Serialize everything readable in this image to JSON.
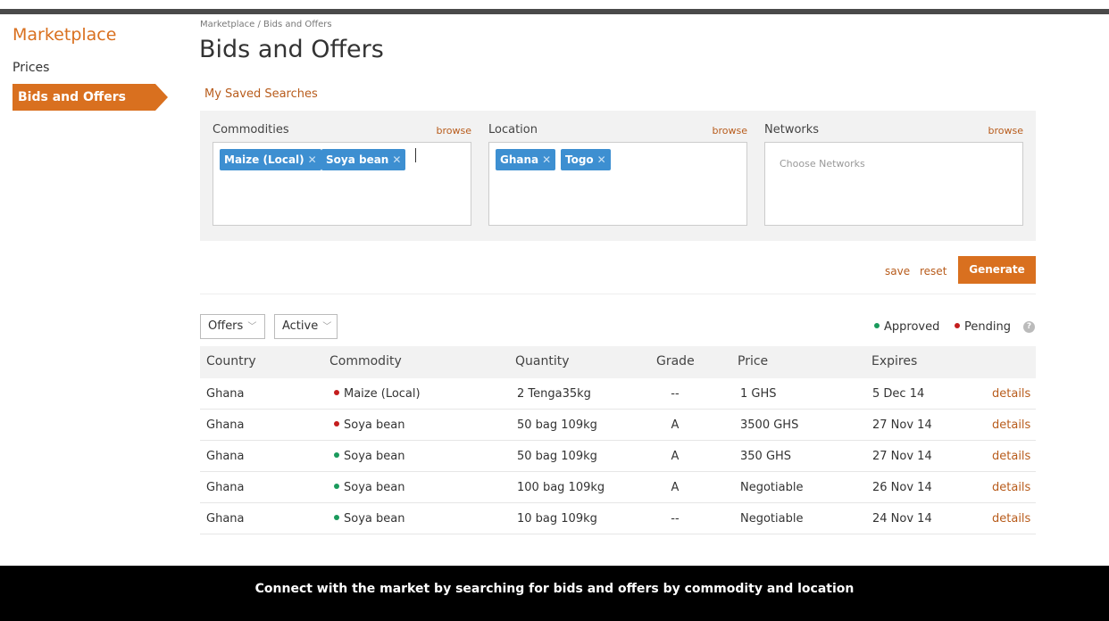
{
  "sidebar": {
    "title": "Marketplace",
    "items": [
      {
        "label": "Prices"
      },
      {
        "label": "Bids and Offers"
      }
    ]
  },
  "header": {
    "breadcrumb": "Marketplace / Bids and Offers",
    "title": "Bids and Offers",
    "saved_searches": "My Saved Searches"
  },
  "filters": {
    "commodities": {
      "label": "Commodities",
      "browse": "browse",
      "tags": [
        "Maize (Local)",
        "Soya bean"
      ]
    },
    "location": {
      "label": "Location",
      "browse": "browse",
      "tags": [
        "Ghana",
        "Togo"
      ]
    },
    "networks": {
      "label": "Networks",
      "browse": "browse",
      "placeholder": "Choose Networks"
    }
  },
  "actions": {
    "save": "save",
    "reset": "reset",
    "generate": "Generate"
  },
  "controls": {
    "type_select": "Offers",
    "status_select": "Active",
    "legend_approved": "Approved",
    "legend_pending": "Pending",
    "help_glyph": "?"
  },
  "colors": {
    "accent": "#d9701f",
    "tag": "#3d8fd1",
    "approved": "#1a9a5c",
    "pending": "#c41e1e"
  },
  "table": {
    "columns": [
      "Country",
      "Commodity",
      "Quantity",
      "Grade",
      "Price",
      "Expires"
    ],
    "rows": [
      {
        "country": "Ghana",
        "status": "pending",
        "commodity": "Maize (Local)",
        "quantity": "2 Tenga35kg",
        "grade": "--",
        "price": "1 GHS",
        "expires": "5 Dec 14",
        "link": "details"
      },
      {
        "country": "Ghana",
        "status": "pending",
        "commodity": "Soya bean",
        "quantity": "50 bag 109kg",
        "grade": "A",
        "price": "3500 GHS",
        "expires": "27 Nov 14",
        "link": "details"
      },
      {
        "country": "Ghana",
        "status": "approved",
        "commodity": "Soya bean",
        "quantity": "50 bag 109kg",
        "grade": "A",
        "price": "350 GHS",
        "expires": "27 Nov 14",
        "link": "details"
      },
      {
        "country": "Ghana",
        "status": "approved",
        "commodity": "Soya bean",
        "quantity": "100 bag 109kg",
        "grade": "A",
        "price": "Negotiable",
        "expires": "26 Nov 14",
        "link": "details"
      },
      {
        "country": "Ghana",
        "status": "approved",
        "commodity": "Soya bean",
        "quantity": "10 bag 109kg",
        "grade": "--",
        "price": "Negotiable",
        "expires": "24 Nov 14",
        "link": "details"
      }
    ]
  },
  "caption": "Connect with the market by searching for bids and offers by commodity and location"
}
